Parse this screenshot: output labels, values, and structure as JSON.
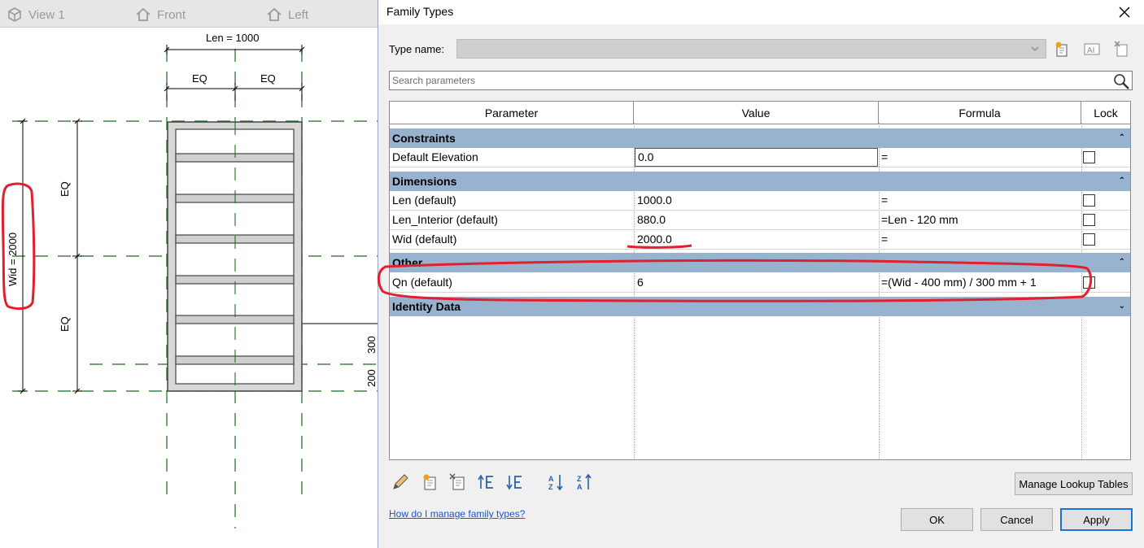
{
  "view_tabs": [
    {
      "label": "View 1",
      "icon": "cube-icon"
    },
    {
      "label": "Front",
      "icon": "house-icon"
    },
    {
      "label": "Left",
      "icon": "house-icon"
    }
  ],
  "drawing": {
    "len_label": "Len = 1000",
    "eq_label": "EQ",
    "wid_label": "Wid = 2000",
    "dim_300": "300",
    "dim_200": "200"
  },
  "dialog": {
    "title": "Family Types",
    "type_name_label": "Type name:",
    "type_name_value": "",
    "search_placeholder": "Search parameters",
    "columns": [
      "Parameter",
      "Value",
      "Formula",
      "Lock"
    ],
    "groups": {
      "constraints": "Constraints",
      "dimensions": "Dimensions",
      "other": "Other",
      "identity": "Identity Data"
    },
    "rows": {
      "default_elevation": {
        "param": "Default Elevation",
        "value": "0.0",
        "formula": "="
      },
      "len": {
        "param": "Len (default)",
        "value": "1000.0",
        "formula": "="
      },
      "len_interior": {
        "param": "Len_Interior (default)",
        "value": "880.0",
        "formula": "=Len - 120 mm"
      },
      "wid": {
        "param": "Wid (default)",
        "value": "2000.0",
        "formula": "="
      },
      "qn": {
        "param": "Qn (default)",
        "value": "6",
        "formula": "=(Wid - 400 mm) / 300 mm + 1"
      }
    },
    "manage_lookup_label": "Manage Lookup Tables",
    "help_link": "How do I manage family types?",
    "ok_label": "OK",
    "cancel_label": "Cancel",
    "apply_label": "Apply"
  },
  "colors": {
    "group_band": "#98b3cf",
    "annotation_red": "#e0202e",
    "reference_green": "#1e6b1e",
    "accent_blue": "#1a73d9"
  }
}
